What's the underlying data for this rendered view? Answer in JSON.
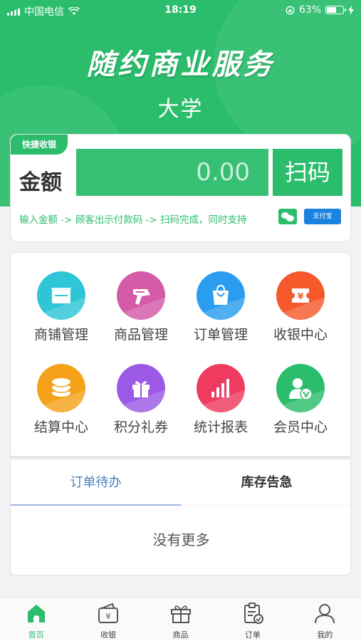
{
  "status_bar": {
    "carrier": "中国电信",
    "time": "18:19",
    "battery_percent": "63%",
    "battery_level": 0.63
  },
  "header": {
    "title": "随约商业服务",
    "subtitle": "大学"
  },
  "quick_pay": {
    "tag": "快捷收银",
    "amount_label": "金额",
    "amount_value": "0.00",
    "scan_button": "扫码",
    "hint": "输入金额 -> 顾客出示付款码 -> 扫码完成，同时支持",
    "alipay_badge": "支付宝"
  },
  "functions": [
    {
      "label": "商铺管理",
      "icon": "store-icon",
      "color": "#2ec6d6"
    },
    {
      "label": "商品管理",
      "icon": "scanner-icon",
      "color": "#d55aa8"
    },
    {
      "label": "订单管理",
      "icon": "shopping-bag-icon",
      "color": "#2a9df0"
    },
    {
      "label": "收银中心",
      "icon": "ticket-yuan-icon",
      "color": "#f5592c"
    },
    {
      "label": "结算中心",
      "icon": "coins-icon",
      "color": "#f5a21a"
    },
    {
      "label": "积分礼券",
      "icon": "gift-icon",
      "color": "#9b59e6"
    },
    {
      "label": "统计报表",
      "icon": "bar-chart-icon",
      "color": "#ee3b5f"
    },
    {
      "label": "会员中心",
      "icon": "member-icon",
      "color": "#2bbd6c"
    }
  ],
  "tabs": {
    "active": "订单待办",
    "inactive": "库存告急"
  },
  "empty_text": "没有更多",
  "bottom_nav": [
    {
      "label": "首页",
      "icon": "home-icon",
      "active": true
    },
    {
      "label": "收银",
      "icon": "wallet-yuan-icon",
      "active": false
    },
    {
      "label": "商品",
      "icon": "gift-box-icon",
      "active": false
    },
    {
      "label": "订单",
      "icon": "clipboard-check-icon",
      "active": false
    },
    {
      "label": "我的",
      "icon": "user-icon",
      "active": false
    }
  ],
  "colors": {
    "brand_green": "#2bbd6c",
    "tab_active_blue": "#4a7fc1",
    "alipay_blue": "#1a83e0"
  }
}
